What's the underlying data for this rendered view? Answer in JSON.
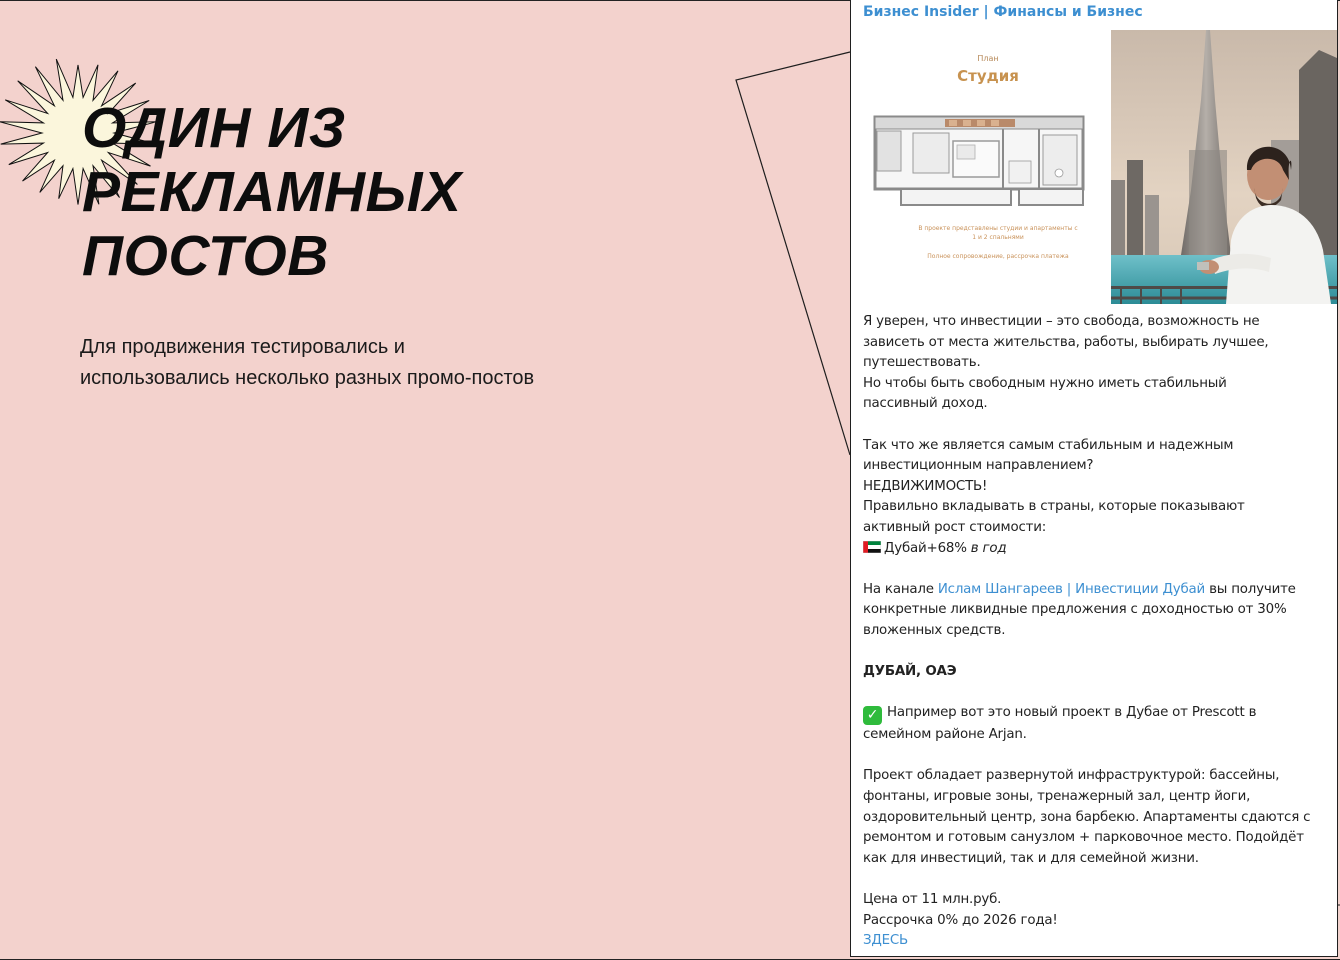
{
  "slide": {
    "headline_lines": [
      "ОДИН ИЗ",
      "РЕКЛАМНЫХ",
      "ПОСТОВ"
    ],
    "subtitle_line1": "Для продвижения тестировались и",
    "subtitle_line2": "использовались несколько разных промо-постов",
    "decor_icon": "starburst-icon"
  },
  "colors": {
    "background": "#f3d2cd",
    "link": "#3d8fd1",
    "starburst_fill": "#fbf6dc",
    "plan_accent": "#c7924f"
  },
  "post": {
    "channel_name": "Бизнес Insider | Финансы и Бизнес",
    "plan_media": {
      "small_label": "План",
      "title": "Студия",
      "note": "В проекте представлены студии и апартаменты с 1 и 2 спальнями",
      "note_2": "Полное сопровождение, рассрочка платежа"
    },
    "photo_alt": "Man in white shirt in front of Burj Khalifa, Dubai",
    "p1_l1": "Я уверен, что инвестиции – это свобода, возможность не",
    "p1_l2": "зависеть от места жительства, работы, выбирать лучшее,",
    "p1_l3": "путешествовать.",
    "p1_l4": "Но чтобы быть свободным нужно иметь стабильный",
    "p1_l5": "пассивный доход.",
    "p2_l1": "Так что же является самым стабильным и надежным",
    "p2_l2": "инвестиционным направлением?",
    "p2_l3": "НЕДВИЖИМОСТЬ!",
    "p2_l4": "Правильно вкладывать в страны, которые показывают",
    "p2_l5": "активный рост стоимости:",
    "p2_dubai": "Дубай+68% ",
    "p2_dubai_italic": "в год",
    "p3_prefix": "На канале ",
    "p3_link": "Ислам Шангареев | Инвестиции Дубай",
    "p3_suffix": " вы получите",
    "p3_l2": "конкретные ликвидные предложения с доходностью от 30%",
    "p3_l3": "вложенных средств.",
    "p4_heading": "ДУБАЙ, ОАЭ",
    "p5_l1": "Например вот это новый проект в Дубае от Prescott в",
    "p5_l2": "семейном районе Arjan.",
    "p6_l1": "Проект обладает развернутой инфраструктурой: бассейны,",
    "p6_l2": "фонтаны, игровые зоны, тренажерный зал, центр йоги,",
    "p6_l3": "оздоровительный центр, зона барбекю. Апартаменты сдаются с",
    "p6_l4": "ремонтом и готовым санузлом + парковочное место. Подойдёт",
    "p6_l5": "как для инвестиций, так и для семейной жизни.",
    "p7_l1": "Цена от 11 млн.руб.",
    "p7_l2": "Рассрочка 0% до 2026 года!",
    "cta_link": "ЗДЕСЬ"
  }
}
